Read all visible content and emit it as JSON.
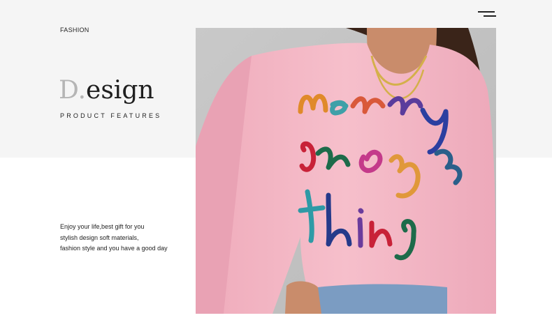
{
  "header": {
    "section_label": "FASHION",
    "menu_icon": "hamburger-menu-icon"
  },
  "hero": {
    "title_first_letter": "D.",
    "title_rest": "esign",
    "subtitle": "PRODUCT FEATURES"
  },
  "description": {
    "lines": [
      "Enjoy your life,best gift for you",
      "stylish design soft materials,",
      "fashion style and you have a good day"
    ]
  },
  "product_image": {
    "subject": "pink-sweater-photo",
    "sweater_color": "#f3b7c4",
    "background_color": "#cfcfcf"
  }
}
